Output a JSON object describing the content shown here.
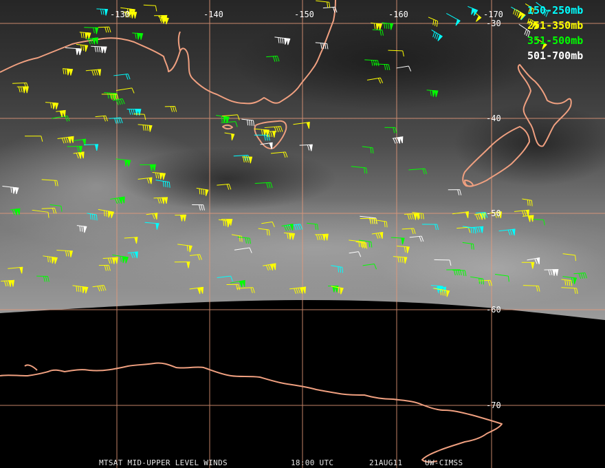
{
  "map": {
    "longitude_ticks": [
      "-130",
      "-140",
      "-150",
      "-160",
      "-170"
    ],
    "latitude_ticks": [
      "-30",
      "-40",
      "-50",
      "-60",
      "-70"
    ],
    "legend": [
      {
        "label": "150-250mb",
        "color": "#00ffff"
      },
      {
        "label": "251-350mb",
        "color": "#ffff00"
      },
      {
        "label": "351-500mb",
        "color": "#00ff00"
      },
      {
        "label": "501-700mb",
        "color": "#ffffff"
      }
    ],
    "footer": {
      "product": "MTSAT MID-UPPER LEVEL WINDS",
      "time": "18:00 UTC",
      "date": "21AUG11",
      "source": "UW-CIMSS"
    },
    "colors": {
      "coastline": "#f0a080",
      "gridline": "#e69a7a",
      "background": "#000000"
    },
    "features": [
      "coastline",
      "graticule",
      "wind-barbs"
    ]
  }
}
